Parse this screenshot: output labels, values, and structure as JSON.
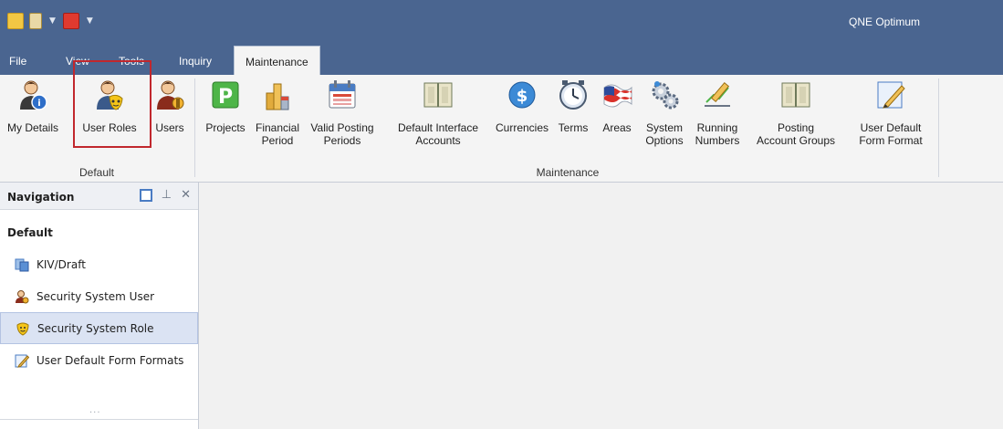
{
  "app": {
    "title": "QNE Optimum"
  },
  "menu": {
    "tabs": [
      {
        "label": "File"
      },
      {
        "label": "View"
      },
      {
        "label": "Tools"
      },
      {
        "label": "Inquiry"
      },
      {
        "label": "Maintenance",
        "active": true
      }
    ]
  },
  "ribbon": {
    "groups": [
      {
        "label": "Default",
        "buttons": [
          {
            "label": "My Details",
            "icon": "user-info-icon"
          },
          {
            "label": "User Roles",
            "icon": "user-roles-icon",
            "highlighted": true
          },
          {
            "label": "Users",
            "icon": "users-icon"
          }
        ]
      },
      {
        "label": "Maintenance",
        "buttons": [
          {
            "label": "Projects",
            "icon": "projects-icon"
          },
          {
            "label": "Financial\nPeriod",
            "icon": "financial-period-icon"
          },
          {
            "label": "Valid Posting\nPeriods",
            "icon": "calendar-icon"
          },
          {
            "label": "Default Interface\nAccounts",
            "icon": "ledger-book-icon"
          },
          {
            "label": "Currencies",
            "icon": "dollar-coin-icon"
          },
          {
            "label": "Terms",
            "icon": "clock-icon"
          },
          {
            "label": "Areas",
            "icon": "flag-icon"
          },
          {
            "label": "System\nOptions",
            "icon": "gears-icon"
          },
          {
            "label": "Running\nNumbers",
            "icon": "pencil-chart-icon"
          },
          {
            "label": "Posting\nAccount Groups",
            "icon": "ledger-book-icon"
          },
          {
            "label": "User Default\nForm Format",
            "icon": "edit-form-icon"
          }
        ]
      }
    ]
  },
  "navigation": {
    "title": "Navigation",
    "section": "Default",
    "items": [
      {
        "label": "KIV/Draft",
        "icon": "draft-icon"
      },
      {
        "label": "Security System User",
        "icon": "security-user-icon"
      },
      {
        "label": "Security System Role",
        "icon": "security-role-icon",
        "selected": true
      },
      {
        "label": "User Default Form Formats",
        "icon": "edit-form-icon"
      }
    ],
    "ellipsis": "..."
  },
  "colors": {
    "titlebar": "#4a6590",
    "ribbon": "#f4f4f4",
    "highlight": "#c1272d",
    "selected": "#dbe3f3"
  }
}
